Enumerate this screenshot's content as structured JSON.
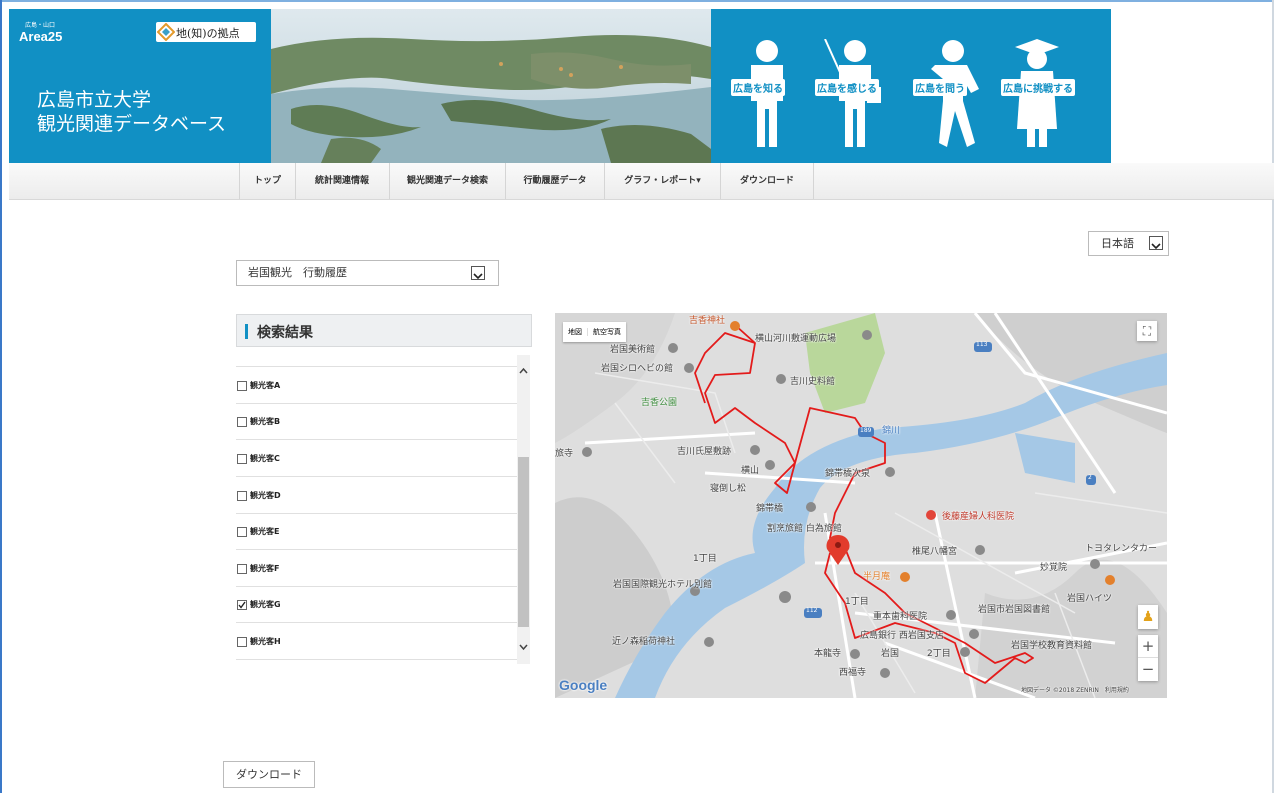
{
  "header": {
    "area_sub": "広島・山口",
    "area_name": "Area25",
    "chiho_label": "地(知)の拠点",
    "site_title_line1": "広島市立大学",
    "site_title_line2": "観光関連データベース",
    "figures": [
      "広島を知る",
      "広島を感じる",
      "広島を問う",
      "広島に挑戦する"
    ],
    "colors": {
      "brand_blue": "#1190c4"
    }
  },
  "nav": {
    "items": [
      "トップ",
      "統計関連情報",
      "観光関連データ検索",
      "行動履歴データ",
      "グラフ・レポート▾",
      "ダウンロード"
    ]
  },
  "language": {
    "selected": "日本語"
  },
  "dataset_select": {
    "selected": "岩国観光　行動履歴"
  },
  "results": {
    "title": "検索結果",
    "items": [
      {
        "label": "観光客A",
        "checked": false
      },
      {
        "label": "観光客B",
        "checked": false
      },
      {
        "label": "観光客C",
        "checked": false
      },
      {
        "label": "観光客D",
        "checked": false
      },
      {
        "label": "観光客E",
        "checked": false
      },
      {
        "label": "観光客F",
        "checked": false
      },
      {
        "label": "観光客G",
        "checked": true
      },
      {
        "label": "観光客H",
        "checked": false
      }
    ]
  },
  "map": {
    "type_map": "地図",
    "type_satellite": "航空写真",
    "labels": {
      "kikko_jinja": "吉香神社",
      "kasenjiki": "横山河川敷運動広場",
      "bijutsukan": "岩国美術館",
      "shirohebi": "岩国シロヘビの館",
      "kikkawa_shiryokan": "吉川史料館",
      "kikko_koen": "吉香公園",
      "kintaikyo_river": "錦川",
      "kikkawa_yashiki": "吉川氏屋敷跡",
      "yokoyama": "横山",
      "negaeshi": "寝倒し松",
      "nishiki_obi": "錦帯橋次泉",
      "kintaikyo": "錦帯橋",
      "kappo": "割烹旅館 白為旅館",
      "goto_clinic": "後藤産婦人科医院",
      "hachiman": "椎尾八幡宮",
      "toyota_rent": "トヨタレンタカー",
      "myokakuji": "妙覚院",
      "kokusai_kanko": "岩国国際観光ホテル別館",
      "hangetsu": "半月庵",
      "shigemoto_clinic": "重本歯科医院",
      "library": "岩国市岩国図書館",
      "hiroshima_bank": "広島銀行 西岩国支店",
      "honkakuji": "本龍寺",
      "iwakuni": "岩国",
      "saifukuji": "西福寺",
      "edu_museum": "岩国学校教育資料館",
      "chinju": "近ノ森稲荷神社",
      "tojoji": "旅寺",
      "heights": "岩国ハイツ",
      "chome1": "1丁目",
      "chome2": "2丁目",
      "chome1b": "1丁目",
      "route_113": "113",
      "route_112": "112",
      "route_2": "2",
      "route_189": "189",
      "copyright": "地図データ ©2018 ZENRIN　利用規約",
      "google": "Google"
    },
    "controls": {
      "zoom_in": "+",
      "zoom_out": "−"
    }
  },
  "download_button": "ダウンロード"
}
